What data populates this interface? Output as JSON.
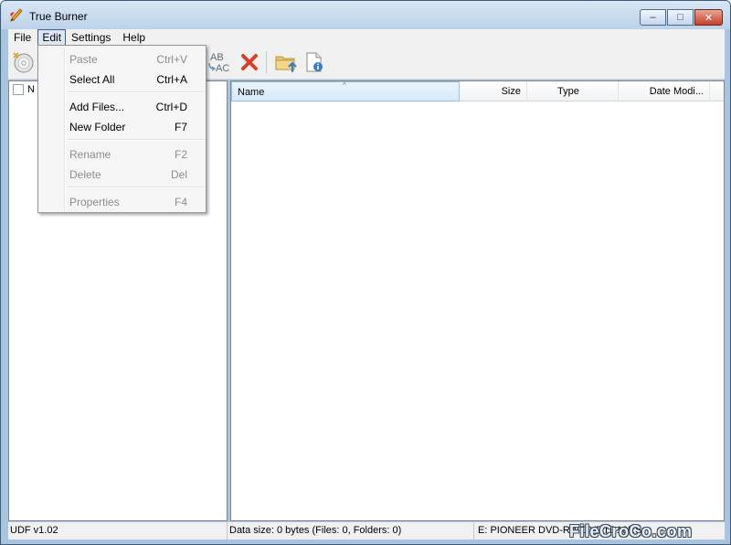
{
  "window": {
    "title": "True Burner",
    "controls": {
      "minimize": "–",
      "maximize": "□",
      "close": "✕"
    }
  },
  "menubar": {
    "items": [
      {
        "label": "File"
      },
      {
        "label": "Edit",
        "active": true
      },
      {
        "label": "Settings"
      },
      {
        "label": "Help"
      }
    ]
  },
  "edit_menu": {
    "items": [
      {
        "label": "Paste",
        "shortcut": "Ctrl+V",
        "enabled": false
      },
      {
        "label": "Select All",
        "shortcut": "Ctrl+A",
        "enabled": true
      },
      {
        "label": "Add Files...",
        "shortcut": "Ctrl+D",
        "enabled": true
      },
      {
        "label": "New Folder",
        "shortcut": "F7",
        "enabled": true
      },
      {
        "label": "Rename",
        "shortcut": "F2",
        "enabled": false
      },
      {
        "label": "Delete",
        "shortcut": "Del",
        "enabled": false
      },
      {
        "label": "Properties",
        "shortcut": "F4",
        "enabled": false
      }
    ]
  },
  "toolbar": {
    "rename_icon_text": "AB",
    "rename_icon_text2": "AC",
    "icons": [
      "disc-icon",
      "rename-icon",
      "delete-icon",
      "folder-up-icon",
      "properties-icon"
    ]
  },
  "tree": {
    "root_label": "N"
  },
  "file_list": {
    "columns": [
      {
        "label": "Name",
        "sorted": true
      },
      {
        "label": "Size"
      },
      {
        "label": "Type"
      },
      {
        "label": "Date Modi..."
      }
    ],
    "rows": []
  },
  "statusbar": {
    "format": "UDF v1.02",
    "data_size": "Data size: 0 bytes (Files: 0, Folders: 0)",
    "drive": "E: PIONEER DVD-RW DVRTD10RS"
  },
  "watermark": "FileCroCo.com",
  "colors": {
    "accent": "#3c6090",
    "delete_red": "#d9402b",
    "folder_yellow": "#e8c46a"
  }
}
